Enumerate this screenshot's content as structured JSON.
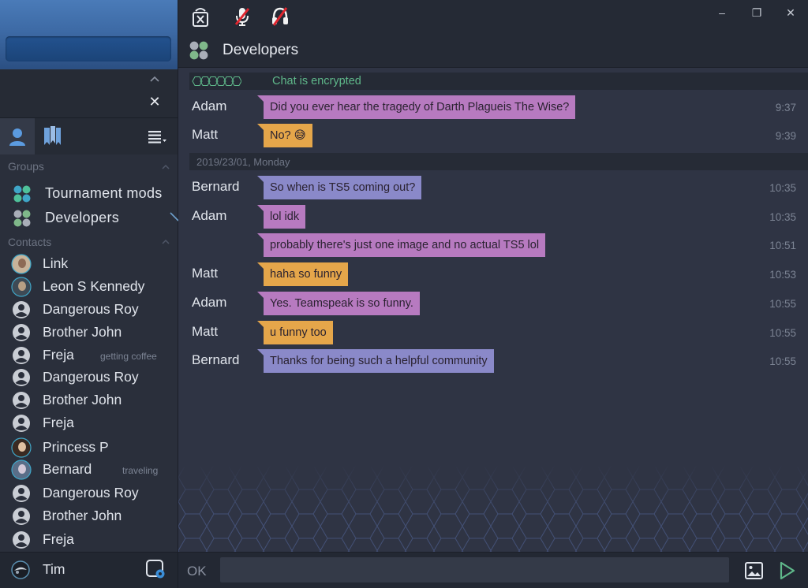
{
  "sidebar": {
    "groups_header": "Groups",
    "contacts_header": "Contacts",
    "groups": [
      {
        "label": "Tournament mods"
      },
      {
        "label": "Developers"
      }
    ],
    "contacts": [
      {
        "name": "Link",
        "status": "",
        "avatar": "photo-link"
      },
      {
        "name": "Leon S Kennedy",
        "status": "",
        "avatar": "photo-leon"
      },
      {
        "name": "Dangerous Roy",
        "status": "",
        "avatar": "default"
      },
      {
        "name": "Brother John",
        "status": "",
        "avatar": "default"
      },
      {
        "name": "Freja",
        "status": "getting coffee",
        "avatar": "default"
      },
      {
        "name": "Dangerous Roy",
        "status": "",
        "avatar": "default"
      },
      {
        "name": "Brother John",
        "status": "",
        "avatar": "default"
      },
      {
        "name": "Freja",
        "status": "",
        "avatar": "default"
      },
      {
        "name": "Princess P",
        "status": "",
        "avatar": "photo-princess"
      },
      {
        "name": "Bernard",
        "status": "traveling",
        "avatar": "photo-bernard"
      },
      {
        "name": "Dangerous Roy",
        "status": "",
        "avatar": "default"
      },
      {
        "name": "Brother John",
        "status": "",
        "avatar": "default"
      },
      {
        "name": "Freja",
        "status": "",
        "avatar": "default"
      }
    ],
    "footer": {
      "user_name": "Tim"
    }
  },
  "chat": {
    "title": "Developers",
    "encrypted_label": "Chat is encrypted",
    "date_separator": "2019/23/01, Monday",
    "messages_before": [
      {
        "sender": "Adam",
        "text": "Did you ever hear the tragedy of Darth Plagueis The Wise?",
        "time": "9:37",
        "color": "#b77ac0"
      },
      {
        "sender": "Matt",
        "text": "No? 😅",
        "time": "9:39",
        "color": "#e5a64a"
      }
    ],
    "messages_after": [
      {
        "sender": "Bernard",
        "text": "So when is TS5 coming out?",
        "time": "10:35",
        "color": "#8a89c9"
      },
      {
        "sender": "Adam",
        "text": "lol idk",
        "time": "10:35",
        "color": "#b77ac0"
      },
      {
        "sender": "",
        "text": "probably there's just one image and no actual TS5 lol",
        "time": "10:51",
        "color": "#b77ac0"
      },
      {
        "sender": "Matt",
        "text": "haha so funny",
        "time": "10:53",
        "color": "#e5a64a"
      },
      {
        "sender": "Adam",
        "text": "Yes. Teamspeak is so funny.",
        "time": "10:55",
        "color": "#b77ac0"
      },
      {
        "sender": "Matt",
        "text": "u funny too",
        "time": "10:55",
        "color": "#e5a64a"
      },
      {
        "sender": "Bernard",
        "text": "Thanks for being such a helpful community",
        "time": "10:55",
        "color": "#8a89c9"
      }
    ]
  },
  "input": {
    "label": "OK",
    "value": "",
    "placeholder": ""
  },
  "icons": {
    "toolbar": [
      "disconnect-icon",
      "microphone-muted-icon",
      "headset-muted-icon"
    ],
    "window": [
      "minimize-icon",
      "restore-icon",
      "close-icon"
    ]
  },
  "colors": {
    "sidebar_bg": "#2a2f3b",
    "chat_bg": "#2f3444",
    "accent_green": "#5fb88a",
    "bubble_purple": "#b77ac0",
    "bubble_orange": "#e5a64a",
    "bubble_blue": "#8a89c9"
  }
}
